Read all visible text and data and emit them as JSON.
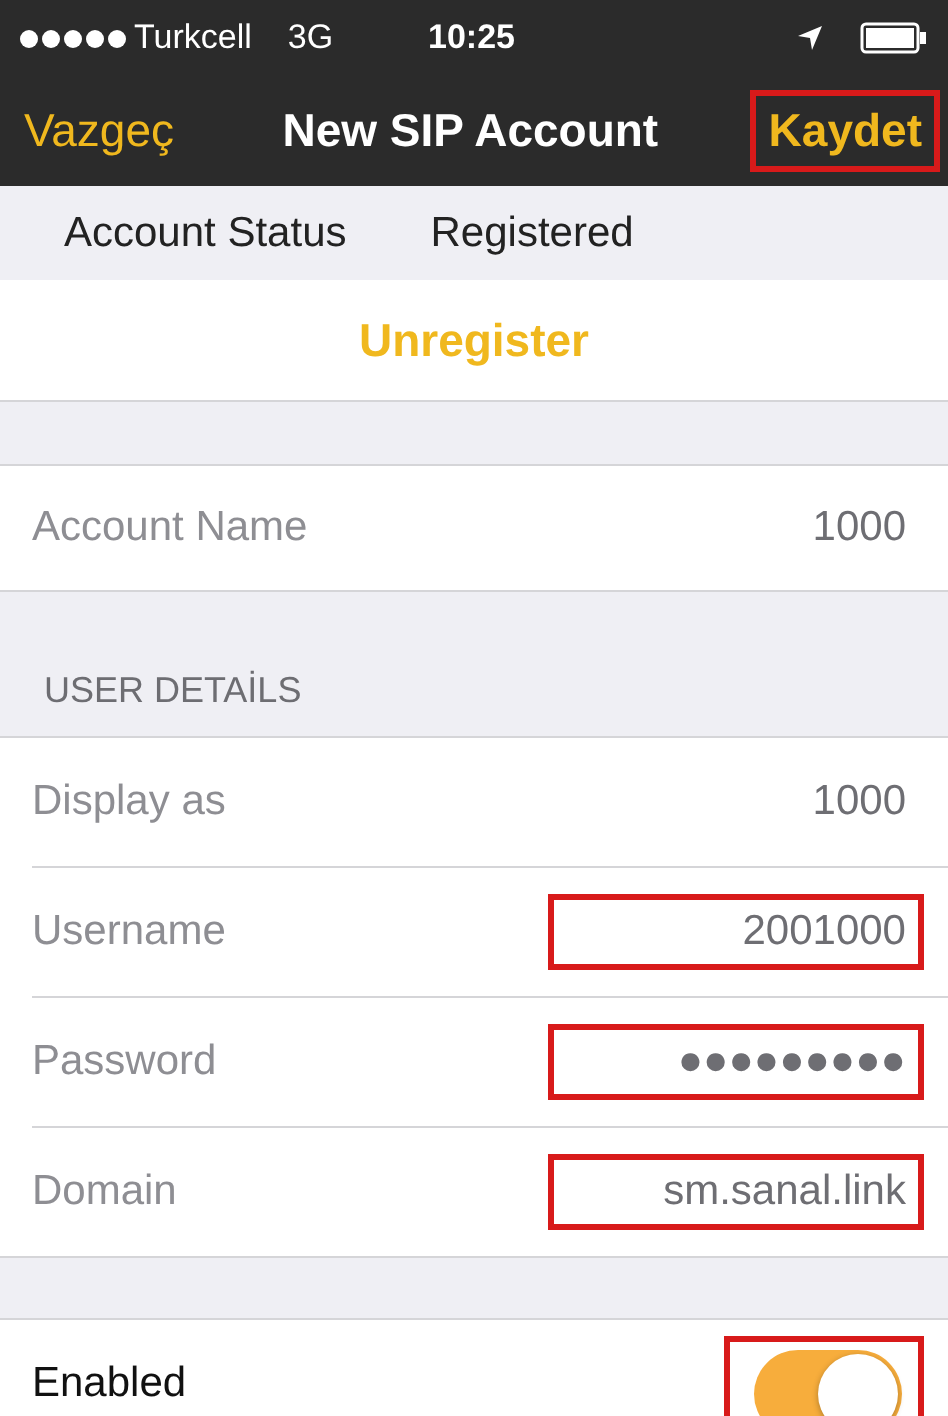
{
  "status_bar": {
    "carrier": "Turkcell",
    "network": "3G",
    "time": "10:25"
  },
  "nav": {
    "cancel": "Vazgeç",
    "title": "New SIP Account",
    "save": {
      "label": "Kaydet",
      "highlighted": true
    }
  },
  "account_status": {
    "label": "Account Status",
    "value": "Registered"
  },
  "unregister": "Unregister",
  "account_name": {
    "label": "Account Name",
    "value": "1000"
  },
  "user_details": {
    "header": "USER DETAİLS",
    "rows": [
      {
        "label": "Display as",
        "value": "1000",
        "highlighted": false
      },
      {
        "label": "Username",
        "value": "2001000",
        "highlighted": true
      },
      {
        "label": "Password",
        "value": "●●●●●●●●●",
        "highlighted": true
      },
      {
        "label": "Domain",
        "value": "sm.sanal.link",
        "highlighted": true
      }
    ]
  },
  "enabled": {
    "label": "Enabled",
    "on": true,
    "highlighted": true
  }
}
